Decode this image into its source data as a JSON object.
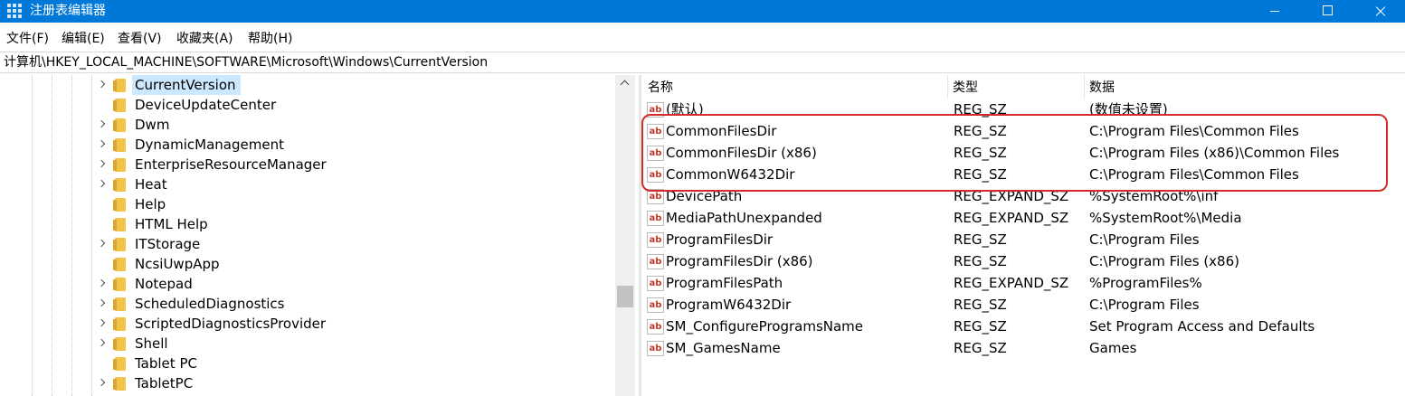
{
  "window": {
    "title": "注册表编辑器"
  },
  "menu": [
    "文件(F)",
    "编辑(E)",
    "查看(V)",
    "收藏夹(A)",
    "帮助(H)"
  ],
  "address": "计算机\\HKEY_LOCAL_MACHINE\\SOFTWARE\\Microsoft\\Windows\\CurrentVersion",
  "tree": {
    "selected": "CurrentVersion",
    "items": [
      "CurrentVersion",
      "DeviceUpdateCenter",
      "Dwm",
      "DynamicManagement",
      "EnterpriseResourceManager",
      "Heat",
      "Help",
      "HTML Help",
      "ITStorage",
      "NcsiUwpApp",
      "Notepad",
      "ScheduledDiagnostics",
      "ScriptedDiagnosticsProvider",
      "Shell",
      "Tablet PC",
      "TabletPC"
    ]
  },
  "columns": {
    "name": "名称",
    "type": "类型",
    "data": "数据"
  },
  "icon_glyph": "ab",
  "values": [
    {
      "name": "(默认)",
      "type": "REG_SZ",
      "data": "(数值未设置)"
    },
    {
      "name": "CommonFilesDir",
      "type": "REG_SZ",
      "data": "C:\\Program Files\\Common Files"
    },
    {
      "name": "CommonFilesDir (x86)",
      "type": "REG_SZ",
      "data": "C:\\Program Files (x86)\\Common Files"
    },
    {
      "name": "CommonW6432Dir",
      "type": "REG_SZ",
      "data": "C:\\Program Files\\Common Files"
    },
    {
      "name": "DevicePath",
      "type": "REG_EXPAND_SZ",
      "data": "%SystemRoot%\\inf"
    },
    {
      "name": "MediaPathUnexpanded",
      "type": "REG_EXPAND_SZ",
      "data": "%SystemRoot%\\Media"
    },
    {
      "name": "ProgramFilesDir",
      "type": "REG_SZ",
      "data": "C:\\Program Files"
    },
    {
      "name": "ProgramFilesDir (x86)",
      "type": "REG_SZ",
      "data": "C:\\Program Files (x86)"
    },
    {
      "name": "ProgramFilesPath",
      "type": "REG_EXPAND_SZ",
      "data": "%ProgramFiles%"
    },
    {
      "name": "ProgramW6432Dir",
      "type": "REG_SZ",
      "data": "C:\\Program Files"
    },
    {
      "name": "SM_ConfigureProgramsName",
      "type": "REG_SZ",
      "data": "Set Program Access and Defaults"
    },
    {
      "name": "SM_GamesName",
      "type": "REG_SZ",
      "data": "Games"
    }
  ],
  "colors": {
    "titlebar": "#0078d7",
    "selection": "#cce8ff",
    "highlight_box": "#d62b2b",
    "folder": "#f2c54a"
  }
}
